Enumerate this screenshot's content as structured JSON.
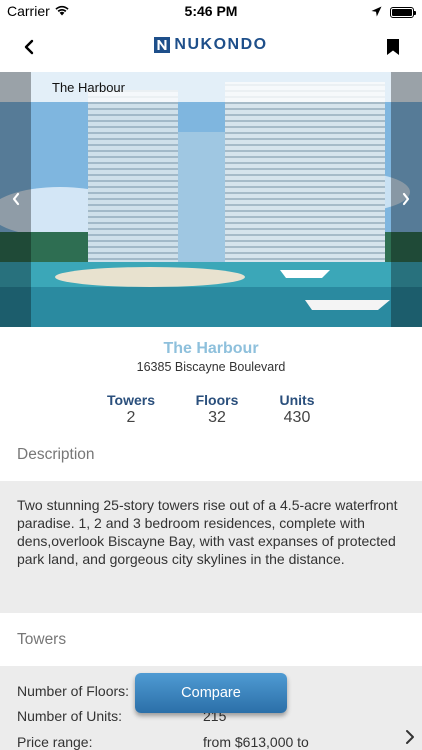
{
  "status_bar": {
    "carrier": "Carrier",
    "time": "5:46 PM"
  },
  "nav": {
    "logo_text": "NUKONDO",
    "brand_color": "#1e4f8a"
  },
  "hero": {
    "title": "The Harbour"
  },
  "project": {
    "name": "The Harbour",
    "address": "16385 Biscayne Boulevard"
  },
  "stats": [
    {
      "label": "Towers",
      "value": "2"
    },
    {
      "label": "Floors",
      "value": "32"
    },
    {
      "label": "Units",
      "value": "430"
    }
  ],
  "description": {
    "title": "Description",
    "text": "Two stunning 25-story towers rise out of a 4.5-acre waterfront paradise.  1, 2 and 3 bedroom residences, complete with dens,overlook Biscayne Bay, with vast expanses of protected park land, and gorgeous city skylines in the distance."
  },
  "towers": {
    "title": "Towers",
    "rows": [
      {
        "label": "Number of Floors:",
        "value": ""
      },
      {
        "label": "Number of Units:",
        "value": "215"
      },
      {
        "label": "Price range:",
        "value": "from $613,000 to"
      }
    ]
  },
  "compare": {
    "label": "Compare"
  }
}
